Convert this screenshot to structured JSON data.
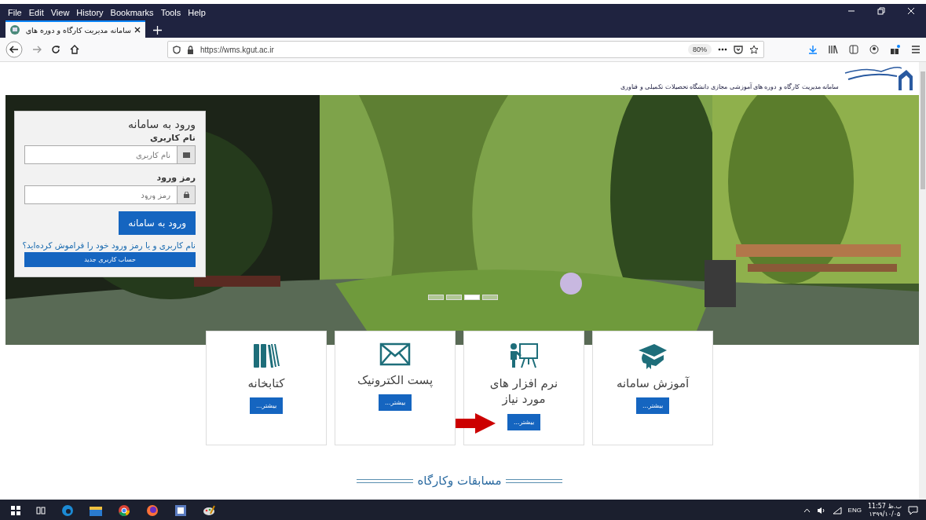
{
  "menu_bar": {
    "file": "File",
    "edit": "Edit",
    "view": "View",
    "history": "History",
    "bookmarks": "Bookmarks",
    "tools": "Tools",
    "help": "Help"
  },
  "tabs": [
    {
      "title": "سامانه مدیریت کارگاه و دوره های",
      "selected": true
    }
  ],
  "address_bar": {
    "url": "https://wms.kgut.ac.ir",
    "zoom": "80%"
  },
  "site_header": {
    "tagline": "سامانه مدیریت کارگاه و دوره های آموزشی مجازی دانشگاه تحصیلات تکمیلی و فناوری"
  },
  "hero": {
    "slides": [
      {
        "selected": false
      },
      {
        "selected": false
      },
      {
        "selected": true
      },
      {
        "selected": false
      }
    ]
  },
  "login": {
    "title": "ورود به سامانه",
    "username_label": "نام کاربری",
    "username_placeholder": "نام کاربری",
    "password_label": "رمز ورود",
    "password_placeholder": "رمز ورود",
    "submit": "ورود به سامانه",
    "forgot_link": "نام کاربری و یا رمز ورود خود را فراموش کرده‌اید؟",
    "register": "حساب کاربری جدید"
  },
  "services": [
    {
      "kind": "tutorial",
      "title": "آموزش سامانه",
      "more": "بیشتر...",
      "pointer_arrow": false
    },
    {
      "kind": "software",
      "title": "نرم افزار های مورد نیاز",
      "more": "بیشتر...",
      "pointer_arrow": true
    },
    {
      "kind": "email",
      "title": "پست الکترونیک",
      "more": "بیشتر...",
      "pointer_arrow": false
    },
    {
      "kind": "library",
      "title": "کتابخانه",
      "more": "بیشتر...",
      "pointer_arrow": false
    }
  ],
  "section_title": "مسابقات وکارگاه",
  "taskbar": {
    "language": "ENG",
    "time": "11:57 ب.ظ",
    "date": "۱۳۹۹/۱۰/۰۵"
  }
}
